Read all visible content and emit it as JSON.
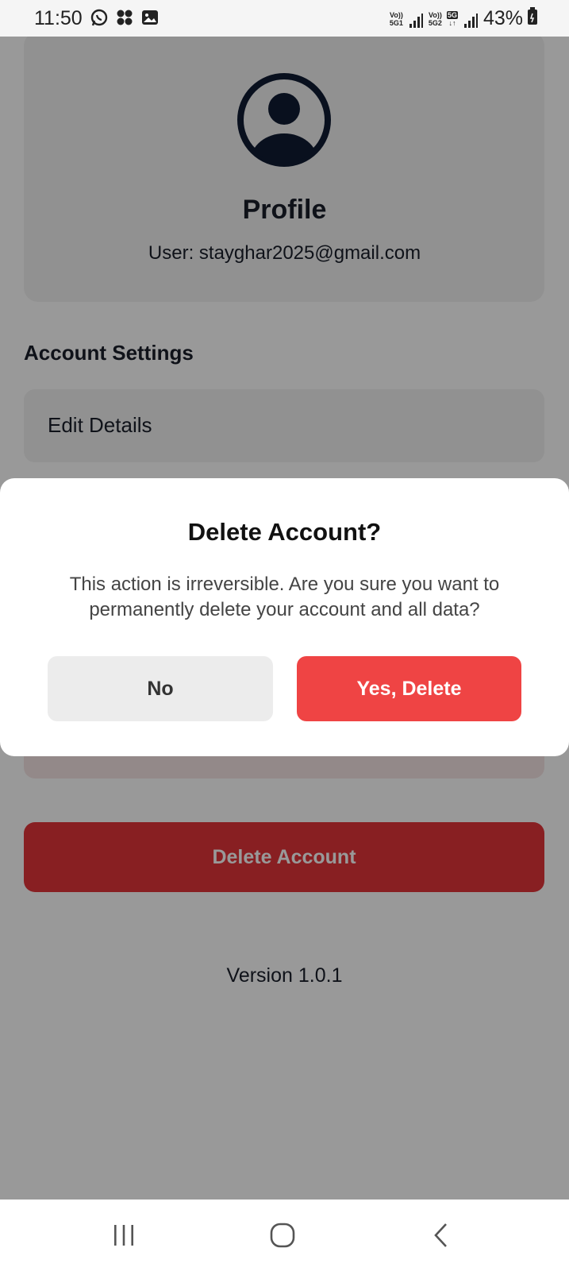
{
  "status_bar": {
    "time": "11:50",
    "sim1_label_top": "Vo))",
    "sim1_label_bottom": "5G1",
    "sim2_label_top": "Vo))",
    "sim2_label_bottom": "5G2",
    "net_type": "5G",
    "battery": "43%"
  },
  "profile": {
    "title": "Profile",
    "user": "User: stayghar2025@gmail.com",
    "avatar_icon": "user-circle-icon"
  },
  "account_settings": {
    "title": "Account Settings",
    "items": [
      {
        "label": "Edit Details"
      }
    ]
  },
  "delete_account_button": "Delete Account",
  "version": "Version 1.0.1",
  "dialog": {
    "title": "Delete Account?",
    "message": "This action is irreversible. Are you sure you want to permanently delete your account and all data?",
    "cancel_label": "No",
    "confirm_label": "Yes, Delete"
  },
  "colors": {
    "danger": "#ef4444",
    "danger_dark": "#e3343a",
    "text_primary": "#1a1f2b",
    "card_bg": "#f2f2f2"
  },
  "nav": {
    "recents_icon": "recents-icon",
    "home_icon": "home-icon",
    "back_icon": "back-icon"
  }
}
